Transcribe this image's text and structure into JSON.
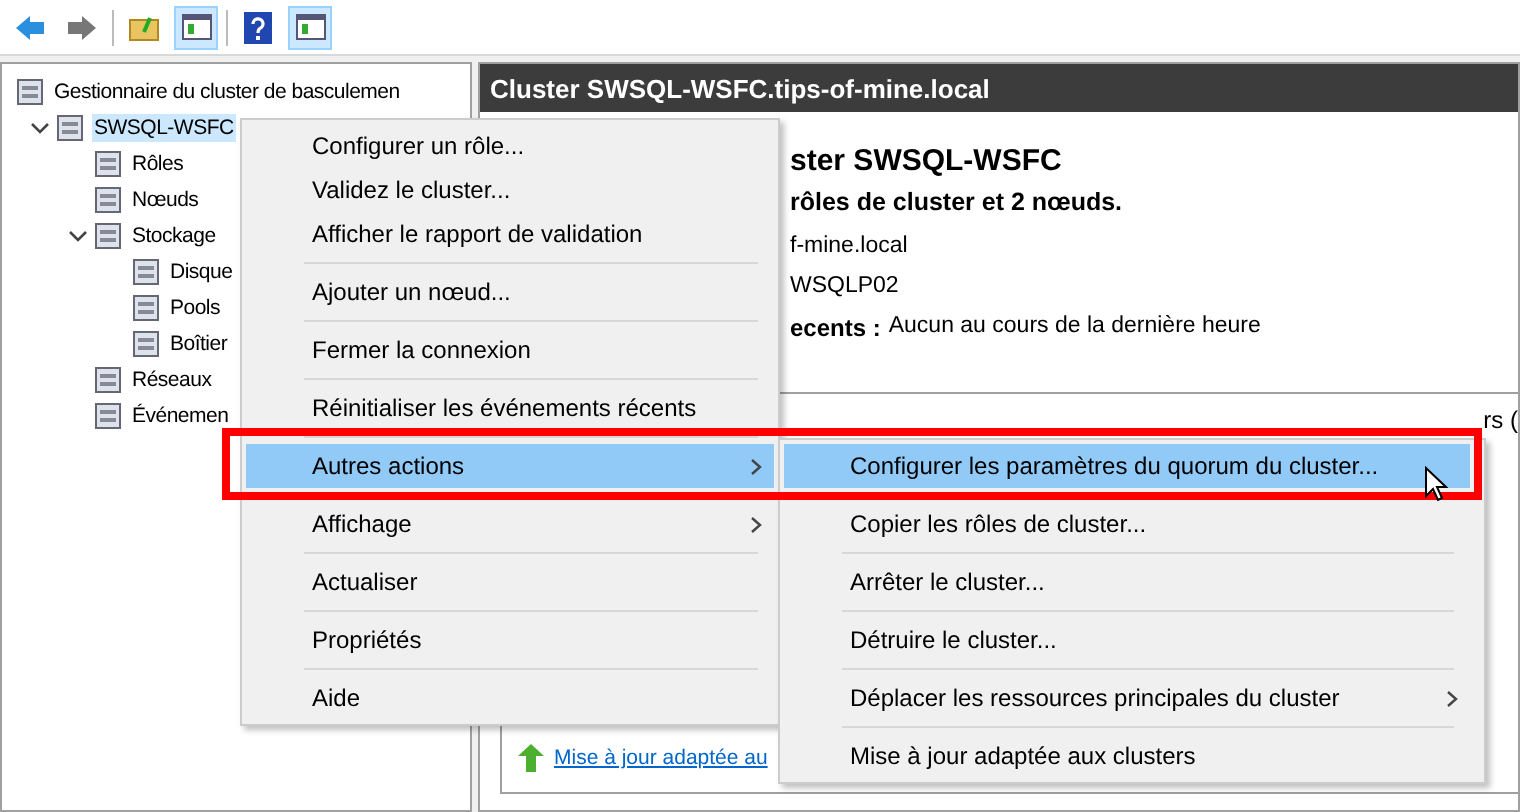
{
  "toolbar": {
    "buttons": [
      {
        "kind": "back",
        "selected": false
      },
      {
        "kind": "forward",
        "selected": false
      },
      {
        "kind": "up",
        "selected": false
      },
      {
        "kind": "pane",
        "selected": true
      },
      {
        "kind": "help",
        "selected": false
      },
      {
        "kind": "pane",
        "selected": true
      }
    ]
  },
  "tree": {
    "items": [
      {
        "label": "Gestionnaire du cluster de basculemen",
        "selected": false,
        "children": [
          {
            "label": "SWSQL-WSFC",
            "selected": true,
            "expanded": true,
            "children": [
              {
                "label": "Rôles",
                "selected": false
              },
              {
                "label": "Nœuds",
                "selected": false
              },
              {
                "label": "Stockage",
                "selected": false,
                "expanded": true,
                "children": [
                  {
                    "label": "Disque",
                    "selected": false
                  },
                  {
                    "label": "Pools",
                    "selected": false
                  },
                  {
                    "label": "Boîtier",
                    "selected": false
                  }
                ]
              },
              {
                "label": "Réseaux",
                "selected": false
              },
              {
                "label": "Événemen",
                "selected": false
              }
            ]
          }
        ]
      }
    ]
  },
  "pane": {
    "title": "Cluster SWSQL-WSFC.tips-of-mine.local",
    "heading": "ster SWSQL-WSFC",
    "subheading": "rôles de cluster et 2 nœuds.",
    "lines": [
      {
        "value": "f-mine.local"
      },
      {
        "value": "WSQLP02"
      },
      {
        "label": "ecents :",
        "value": "Aucun au cours de la dernière heure"
      }
    ],
    "column_text": "rs (",
    "link": "Mise à jour adaptée au"
  },
  "context_menu": {
    "items": [
      {
        "label": "Configurer un rôle...",
        "separator": false,
        "submenu": false,
        "selected": false
      },
      {
        "label": "Validez le cluster...",
        "separator": false,
        "submenu": false,
        "selected": false
      },
      {
        "label": "Afficher le rapport de validation",
        "separator": false,
        "submenu": false,
        "selected": false
      },
      {
        "label": "Ajouter un nœud...",
        "separator": true,
        "submenu": false,
        "selected": false
      },
      {
        "label": "Fermer la connexion",
        "separator": true,
        "submenu": false,
        "selected": false
      },
      {
        "label": "Réinitialiser les événements récents",
        "separator": true,
        "submenu": false,
        "selected": false
      },
      {
        "label": "Autres actions",
        "separator": true,
        "submenu": true,
        "selected": true
      },
      {
        "label": "Affichage",
        "separator": false,
        "submenu": true,
        "selected": false
      },
      {
        "label": "Actualiser",
        "separator": true,
        "submenu": false,
        "selected": false
      },
      {
        "label": "Propriétés",
        "separator": true,
        "submenu": false,
        "selected": false
      },
      {
        "label": "Aide",
        "separator": true,
        "submenu": false,
        "selected": false
      }
    ]
  },
  "submenu": {
    "items": [
      {
        "label": "Configurer les paramètres du quorum du cluster...",
        "separator": false,
        "submenu": false,
        "selected": true
      },
      {
        "label": "Copier les rôles de cluster...",
        "separator": false,
        "submenu": false,
        "selected": false
      },
      {
        "label": "Arrêter le cluster...",
        "separator": true,
        "submenu": false,
        "selected": false
      },
      {
        "label": "Détruire le cluster...",
        "separator": true,
        "submenu": false,
        "selected": false
      },
      {
        "label": "Déplacer les ressources principales du cluster",
        "separator": true,
        "submenu": true,
        "selected": false
      },
      {
        "label": "Mise à jour adaptée aux clusters",
        "separator": true,
        "submenu": false,
        "selected": false
      }
    ]
  },
  "highlight_frame": true
}
